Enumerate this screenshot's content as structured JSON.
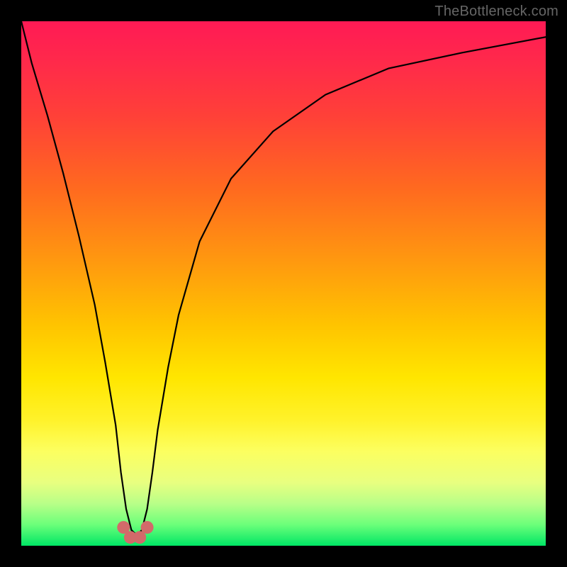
{
  "watermark": "TheBottleneck.com",
  "chart_data": {
    "type": "line",
    "title": "",
    "xlabel": "",
    "ylabel": "",
    "xlim": [
      0,
      100
    ],
    "ylim": [
      0,
      100
    ],
    "grid": false,
    "legend": false,
    "background_gradient": {
      "direction": "vertical",
      "stops": [
        {
          "pos": 0,
          "color": "#ff1a55"
        },
        {
          "pos": 18,
          "color": "#ff4038"
        },
        {
          "pos": 45,
          "color": "#ff9610"
        },
        {
          "pos": 68,
          "color": "#ffe600"
        },
        {
          "pos": 88,
          "color": "#e8ff80"
        },
        {
          "pos": 100,
          "color": "#00e665"
        }
      ]
    },
    "series": [
      {
        "name": "bottleneck-curve",
        "color": "#000000",
        "x": [
          0,
          2,
          5,
          8,
          11,
          14,
          16,
          18,
          19,
          20,
          21,
          22,
          23,
          24,
          25,
          26,
          28,
          30,
          34,
          40,
          48,
          58,
          70,
          84,
          100
        ],
        "y": [
          100,
          92,
          82,
          71,
          59,
          46,
          35,
          23,
          14,
          7,
          3,
          2,
          3,
          7,
          14,
          22,
          34,
          44,
          58,
          70,
          79,
          86,
          91,
          94,
          97
        ]
      }
    ],
    "markers": [
      {
        "name": "valley-marker-left",
        "x": 19.5,
        "y": 3.5,
        "color": "#d26a6a",
        "size": 18
      },
      {
        "name": "valley-marker-bottom1",
        "x": 20.8,
        "y": 1.6,
        "color": "#d26a6a",
        "size": 18
      },
      {
        "name": "valley-marker-bottom2",
        "x": 22.6,
        "y": 1.6,
        "color": "#d26a6a",
        "size": 18
      },
      {
        "name": "valley-marker-right",
        "x": 24.0,
        "y": 3.5,
        "color": "#d26a6a",
        "size": 18
      }
    ]
  }
}
